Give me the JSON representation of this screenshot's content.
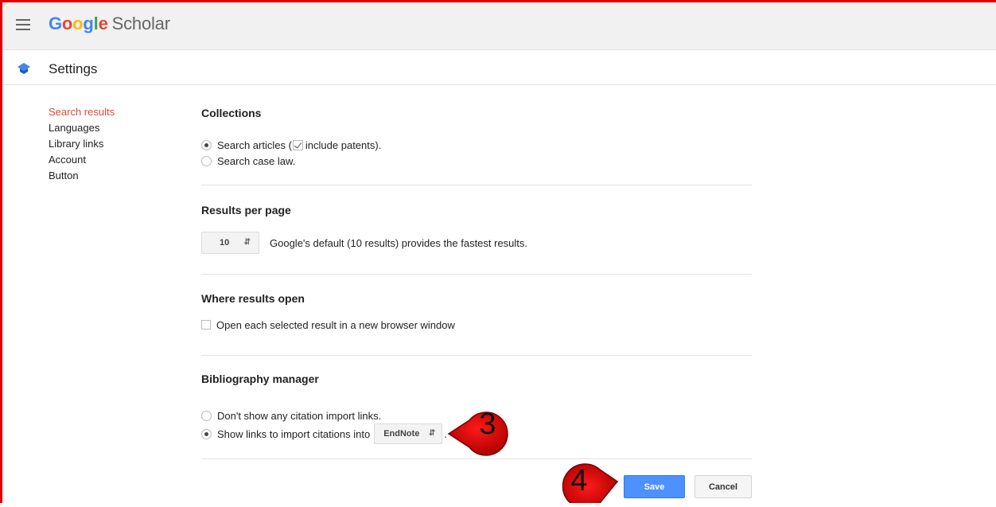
{
  "header": {
    "logo": {
      "g1": "G",
      "o1": "o",
      "o2": "o",
      "g2": "g",
      "l": "l",
      "e": "e",
      "scholar": "Scholar"
    }
  },
  "settings_bar": {
    "title": "Settings"
  },
  "sidebar": {
    "items": [
      {
        "label": "Search results",
        "active": true
      },
      {
        "label": "Languages"
      },
      {
        "label": "Library links"
      },
      {
        "label": "Account"
      },
      {
        "label": "Button"
      }
    ]
  },
  "collections": {
    "title": "Collections",
    "option1_prefix": "Search articles (",
    "option1_suffix": "include patents).",
    "option2": "Search case law."
  },
  "results_per_page": {
    "title": "Results per page",
    "value": "10",
    "hint": "Google's default (10 results) provides the fastest results."
  },
  "where_results_open": {
    "title": "Where results open",
    "checkbox_label": "Open each selected result in a new browser window"
  },
  "bibliography": {
    "title": "Bibliography manager",
    "option1": "Don't show any citation import links.",
    "option2": "Show links to import citations into",
    "manager_value": "EndNote",
    "trailing": "."
  },
  "buttons": {
    "save": "Save",
    "cancel": "Cancel"
  },
  "annotations": {
    "step3": "3",
    "step4": "4"
  },
  "colors": {
    "frame": "#e00000",
    "active_nav": "#dd4b39",
    "save_button": "#4d90fe",
    "marker_fill": "#ee0000"
  }
}
